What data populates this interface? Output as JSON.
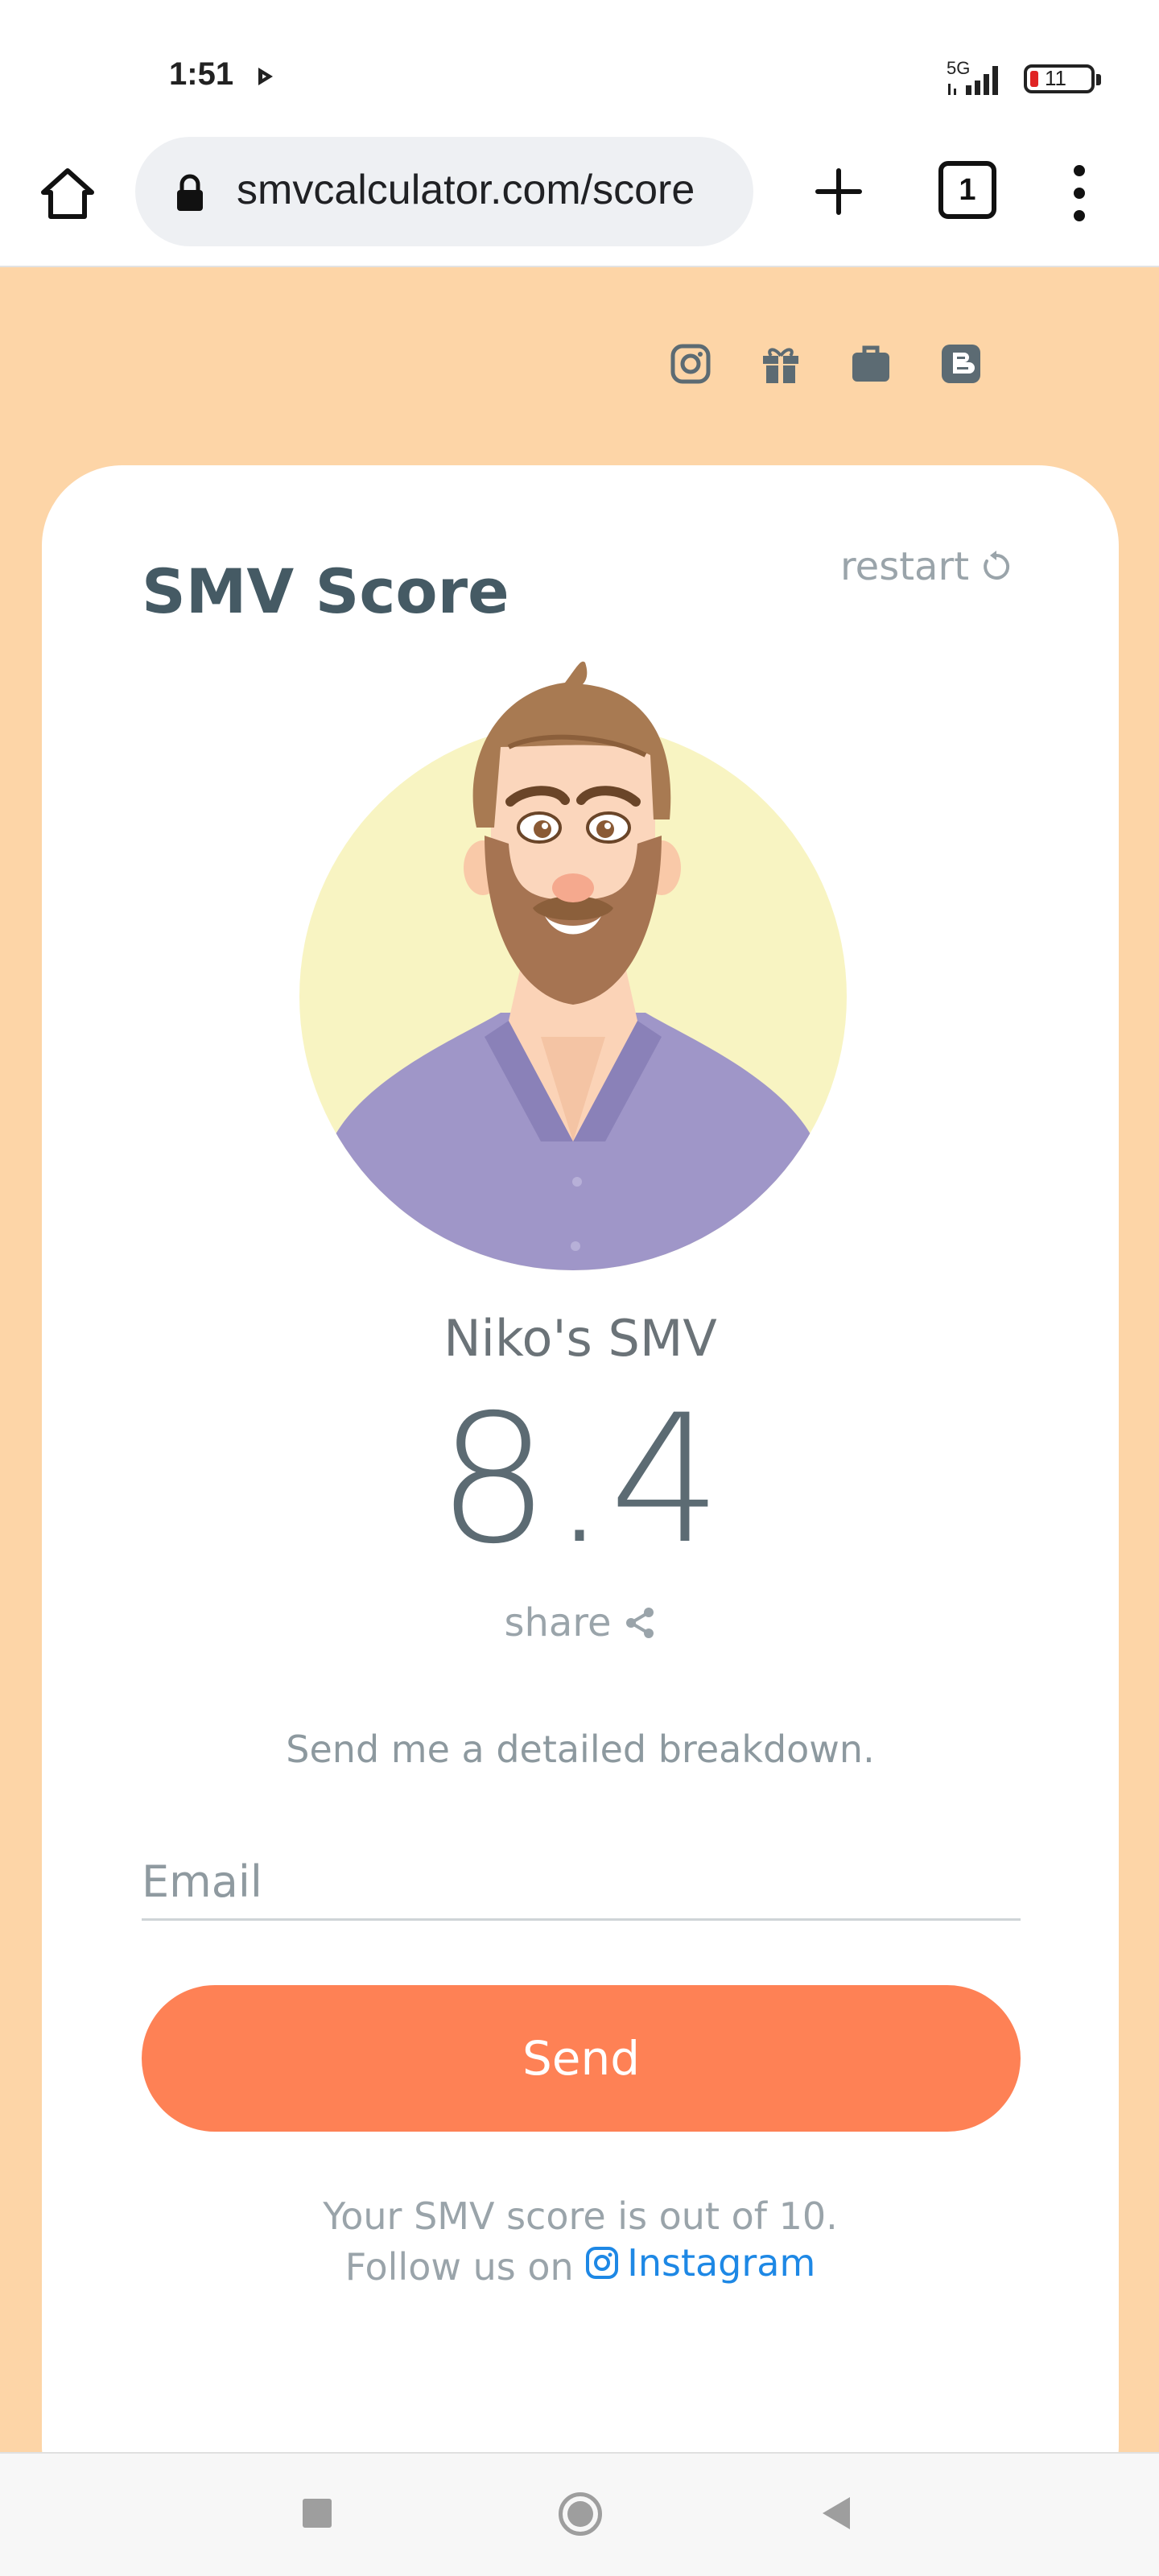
{
  "status_bar": {
    "time": "1:51",
    "network": "5G",
    "battery": "11"
  },
  "browser": {
    "url": "smvcalculator.com/score",
    "tab_count": "1"
  },
  "card": {
    "title": "SMV Score",
    "restart_label": "restart",
    "user_label": "Niko's SMV",
    "score": "8.4",
    "share_label": "share",
    "breakdown_text": "Send me a detailed breakdown.",
    "email_placeholder": "Email",
    "send_label": "Send",
    "footer_line1": "Your SMV score is out of 10.",
    "footer_line2_prefix": "Follow us on",
    "instagram_link": "Instagram"
  },
  "colors": {
    "page_background": "#fdd5a7",
    "accent_button": "#fe8155",
    "link": "#1e88e5",
    "title_text": "#455a64"
  },
  "icons": {
    "social": [
      "instagram-icon",
      "gift-icon",
      "briefcase-icon",
      "blogger-icon"
    ]
  }
}
